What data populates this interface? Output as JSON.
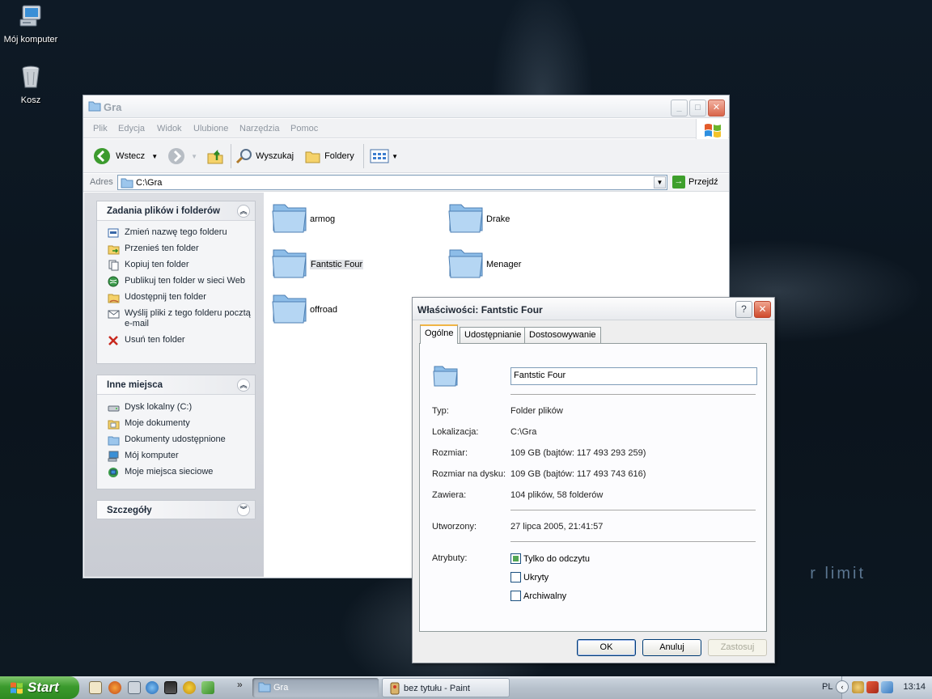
{
  "desktop": {
    "icons": [
      {
        "label": "Mój komputer"
      },
      {
        "label": "Kosz"
      }
    ],
    "wallpaper_text": "r limit"
  },
  "explorer": {
    "title": "Gra",
    "menu": [
      "Plik",
      "Edycja",
      "Widok",
      "Ulubione",
      "Narzędzia",
      "Pomoc"
    ],
    "toolbar": {
      "back": "Wstecz",
      "search": "Wyszukaj",
      "folders": "Foldery"
    },
    "address": {
      "label": "Adres",
      "value": "C:\\Gra",
      "go": "Przejdź"
    },
    "task_pane": {
      "file_tasks": {
        "title": "Zadania plików i folderów",
        "items": [
          "Zmień nazwę tego folderu",
          "Przenieś ten folder",
          "Kopiuj ten folder",
          "Publikuj ten folder w sieci Web",
          "Udostępnij ten folder",
          "Wyślij pliki z tego folderu pocztą e-mail",
          "Usuń ten folder"
        ]
      },
      "other_places": {
        "title": "Inne miejsca",
        "items": [
          "Dysk lokalny (C:)",
          "Moje dokumenty",
          "Dokumenty udostępnione",
          "Mój komputer",
          "Moje miejsca sieciowe"
        ]
      },
      "details": {
        "title": "Szczegóły"
      }
    },
    "folders": [
      "armog",
      "Drake",
      "Fantstic Four",
      "Menager",
      "offroad"
    ]
  },
  "properties": {
    "title": "Właściwości: Fantstic Four",
    "tabs": [
      "Ogólne",
      "Udostępnianie",
      "Dostosowywanie"
    ],
    "name": "Fantstic Four",
    "rows": {
      "type_label": "Typ:",
      "type_value": "Folder plików",
      "location_label": "Lokalizacja:",
      "location_value": "C:\\Gra",
      "size_label": "Rozmiar:",
      "size_value": "109 GB (bajtów: 117 493 293 259)",
      "disk_size_label": "Rozmiar na dysku:",
      "disk_size_value": "109 GB (bajtów: 117 493 743 616)",
      "contains_label": "Zawiera:",
      "contains_value": "104 plików, 58 folderów",
      "created_label": "Utworzony:",
      "created_value": "27 lipca 2005, 21:41:57",
      "attributes_label": "Atrybuty:"
    },
    "attributes": {
      "readonly": "Tylko do odczytu",
      "hidden": "Ukryty",
      "archive": "Archiwalny"
    },
    "buttons": {
      "ok": "OK",
      "cancel": "Anuluj",
      "apply": "Zastosuj"
    }
  },
  "taskbar": {
    "start": "Start",
    "tasks": [
      "Gra",
      "bez tytułu - Paint"
    ],
    "language": "PL",
    "clock": "13:14"
  }
}
